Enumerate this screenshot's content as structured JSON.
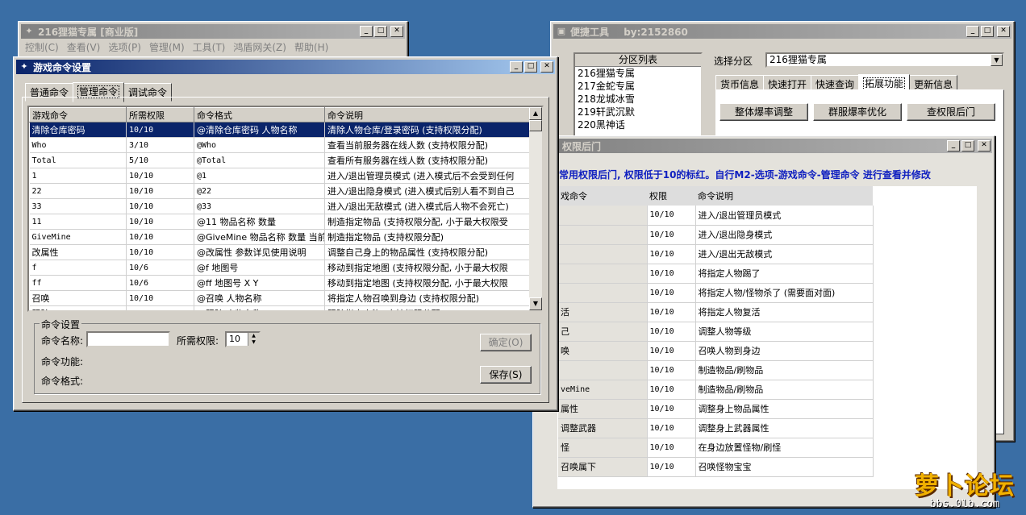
{
  "main_window": {
    "title": "216狸猫专属 [商业版]",
    "menu": [
      "控制(C)",
      "查看(V)",
      "选项(P)",
      "管理(M)",
      "工具(T)",
      "鸿盾网关(Z)",
      "帮助(H)"
    ]
  },
  "cmd_window": {
    "title": "游戏命令设置",
    "tabs": [
      "普通命令",
      "管理命令",
      "调试命令"
    ],
    "columns": [
      "游戏命令",
      "所需权限",
      "命令格式",
      "命令说明"
    ],
    "rows": [
      [
        "清除仓库密码",
        "10/10",
        "@清除仓库密码 人物名称",
        "清除人物仓库/登录密码 (支持权限分配)"
      ],
      [
        "Who",
        "3/10",
        "@Who",
        "查看当前服务器在线人数 (支持权限分配)"
      ],
      [
        "Total",
        "5/10",
        "@Total",
        "查看所有服务器在线人数 (支持权限分配)"
      ],
      [
        "1",
        "10/10",
        "@1",
        "进入/退出管理员模式 (进入模式后不会受到任何"
      ],
      [
        "22",
        "10/10",
        "@22",
        "进入/退出隐身模式 (进入模式后别人看不到自己"
      ],
      [
        "33",
        "10/10",
        "@33",
        "进入/退出无敌模式 (进入模式后人物不会死亡)"
      ],
      [
        "11",
        "10/10",
        "@11 物品名称 数量",
        "制造指定物品 (支持权限分配, 小于最大权限受"
      ],
      [
        "GiveMine",
        "10/10",
        "@GiveMine 物品名称 数量 当前",
        "制造指定物品 (支持权限分配)"
      ],
      [
        "改属性",
        "10/10",
        "@改属性 参数详见使用说明",
        "调整自己身上的物品属性 (支持权限分配)"
      ],
      [
        "f",
        "10/6",
        "@f 地图号",
        "移动到指定地图 (支持权限分配, 小于最大权限"
      ],
      [
        "ff",
        "10/6",
        "@ff 地图号 X Y",
        "移动到指定地图 (支持权限分配, 小于最大权限"
      ],
      [
        "召唤",
        "10/10",
        "@召唤 人物名称",
        "将指定人物召唤到身边 (支持权限分配)"
      ],
      [
        "跟踪",
        "10/10",
        "@跟踪 人物名称",
        "跟踪指定人物 (支持权限分配)"
      ]
    ],
    "settings": {
      "group_title": "命令设置",
      "name_label": "命令名称:",
      "name_value": "",
      "perm_label": "所需权限:",
      "perm_value": "10",
      "func_label": "命令功能:",
      "format_label": "命令格式:",
      "ok_button": "确定(O)",
      "save_button": "保存(S)"
    }
  },
  "tool_window": {
    "title": "便捷工具",
    "by": "by:2152860",
    "list_header": "分区列表",
    "list_items": [
      "216狸猫专属",
      "217金蛇专属",
      "218龙城冰雪",
      "219轩武沉默",
      "220黑神话"
    ],
    "select_label": "选择分区",
    "select_value": "216狸猫专属",
    "tabs": [
      "货币信息",
      "快速打开",
      "快速查询",
      "拓展功能",
      "更新信息"
    ],
    "buttons": [
      "整体爆率调整",
      "群服爆率优化",
      "查权限后门"
    ]
  },
  "backdoor_window": {
    "title": "权限后门",
    "note": "常用权限后门, 权限低于10的标红。自行M2-选项-游戏命令-管理命令 进行查看并修改",
    "columns": [
      "戏命令",
      "权限",
      "命令说明"
    ],
    "rows": [
      [
        "",
        "10/10",
        "进入/退出管理员模式"
      ],
      [
        "",
        "10/10",
        "进入/退出隐身模式"
      ],
      [
        "",
        "10/10",
        "进入/退出无敌模式"
      ],
      [
        "",
        "10/10",
        "将指定人物踢了"
      ],
      [
        "",
        "10/10",
        "将指定人物/怪物杀了 (需要面对面)"
      ],
      [
        "活",
        "10/10",
        "将指定人物复活"
      ],
      [
        "己",
        "10/10",
        "调整人物等级"
      ],
      [
        "唤",
        "10/10",
        "召唤人物到身边"
      ],
      [
        "",
        "10/10",
        "制造物品/刷物品"
      ],
      [
        "veMine",
        "10/10",
        "制造物品/刷物品"
      ],
      [
        "属性",
        "10/10",
        "调整身上物品属性"
      ],
      [
        "调整武器",
        "10/10",
        "调整身上武器属性"
      ],
      [
        "怪",
        "10/10",
        "在身边放置怪物/刷怪"
      ],
      [
        "召唤属下",
        "10/10",
        "召唤怪物宝宝"
      ]
    ]
  },
  "watermark": {
    "main": "萝卜论坛",
    "sub": "bbs.0lb.com"
  }
}
